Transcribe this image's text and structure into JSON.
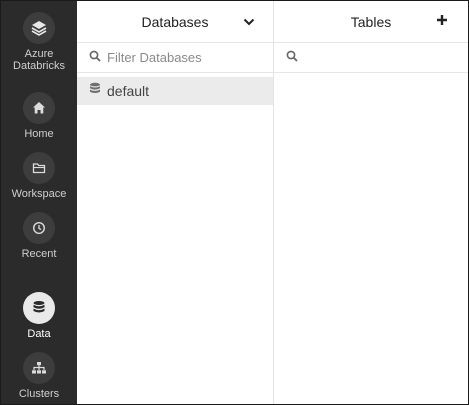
{
  "sidebar": {
    "items": [
      {
        "label": "Azure Databricks",
        "label_line1": "Azure",
        "label_line2": "Databricks",
        "icon": "databricks-logo-icon"
      },
      {
        "label": "Home",
        "icon": "home-icon"
      },
      {
        "label": "Workspace",
        "icon": "folder-icon"
      },
      {
        "label": "Recent",
        "icon": "clock-icon"
      },
      {
        "label": "Data",
        "icon": "database-icon",
        "active": true
      },
      {
        "label": "Clusters",
        "icon": "clusters-icon"
      }
    ]
  },
  "databases": {
    "title": "Databases",
    "filter_placeholder": "Filter Databases",
    "filter_value": "",
    "items": [
      {
        "label": "default",
        "selected": true
      }
    ]
  },
  "tables": {
    "title": "Tables",
    "filter_placeholder": "",
    "filter_value": ""
  },
  "colors": {
    "sidebar_bg": "#2b2b2b",
    "sidebar_icon_bg": "#3d3d3d",
    "active_icon_bg": "#e9e9e9",
    "selected_row_bg": "#ebebeb"
  }
}
